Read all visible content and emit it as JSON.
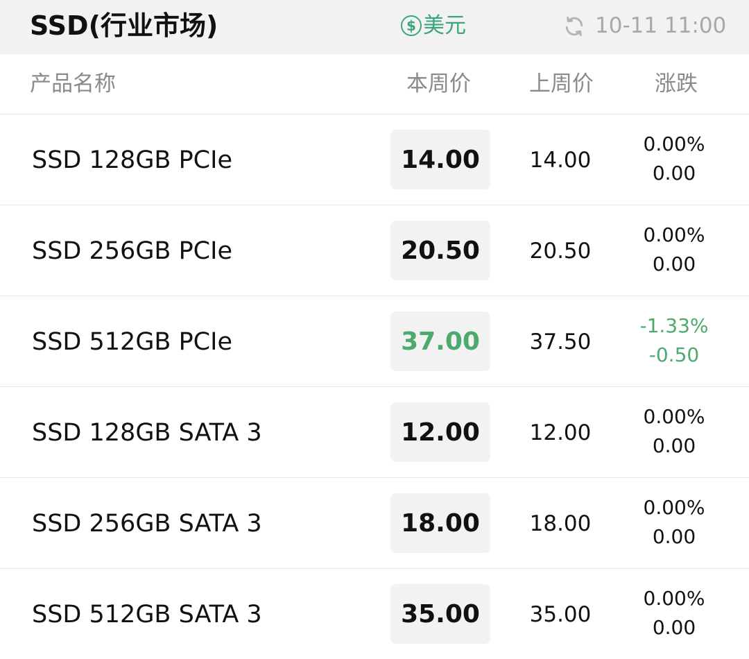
{
  "header": {
    "title": "SSD(行业市场)",
    "currency_symbol": "$",
    "currency_label": "美元",
    "update_time": "10-11 11:00"
  },
  "columns": {
    "name": "产品名称",
    "this_week": "本周价",
    "last_week": "上周价",
    "change": "涨跌"
  },
  "colors": {
    "accent_green": "#3aa77a",
    "down_green": "#4caa6d",
    "muted_gray": "#a8a8a8"
  },
  "rows": [
    {
      "name": "SSD 128GB PCIe",
      "this_week": "14.00",
      "last_week": "14.00",
      "change_pct": "0.00%",
      "change_abs": "0.00",
      "trend": "flat"
    },
    {
      "name": "SSD 256GB PCIe",
      "this_week": "20.50",
      "last_week": "20.50",
      "change_pct": "0.00%",
      "change_abs": "0.00",
      "trend": "flat"
    },
    {
      "name": "SSD 512GB PCIe",
      "this_week": "37.00",
      "last_week": "37.50",
      "change_pct": "-1.33%",
      "change_abs": "-0.50",
      "trend": "down"
    },
    {
      "name": "SSD 128GB SATA 3",
      "this_week": "12.00",
      "last_week": "12.00",
      "change_pct": "0.00%",
      "change_abs": "0.00",
      "trend": "flat"
    },
    {
      "name": "SSD 256GB SATA 3",
      "this_week": "18.00",
      "last_week": "18.00",
      "change_pct": "0.00%",
      "change_abs": "0.00",
      "trend": "flat"
    },
    {
      "name": "SSD 512GB SATA 3",
      "this_week": "35.00",
      "last_week": "35.00",
      "change_pct": "0.00%",
      "change_abs": "0.00",
      "trend": "flat"
    }
  ]
}
